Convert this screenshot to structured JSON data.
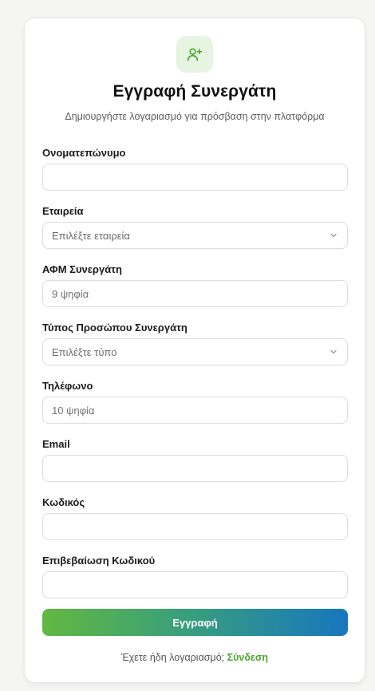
{
  "header": {
    "icon": "user-plus-icon",
    "title": "Εγγραφή Συνεργάτη",
    "subtitle": "Δημιουργήστε λογαριασμό για πρόσβαση στην πλατφόρμα"
  },
  "form": {
    "fullname": {
      "label": "Ονοματεπώνυμο",
      "value": "",
      "placeholder": ""
    },
    "company": {
      "label": "Εταιρεία",
      "selected": "Επιλέξτε εταιρεία"
    },
    "afm": {
      "label": "ΑΦΜ Συνεργάτη",
      "value": "",
      "placeholder": "9 ψηφία"
    },
    "person_type": {
      "label": "Τύπος Προσώπου Συνεργάτη",
      "selected": "Επιλέξτε τύπο"
    },
    "phone": {
      "label": "Τηλέφωνο",
      "value": "",
      "placeholder": "10 ψηφία"
    },
    "email": {
      "label": "Email",
      "value": "",
      "placeholder": ""
    },
    "password": {
      "label": "Κωδικός",
      "value": "",
      "placeholder": ""
    },
    "password_confirm": {
      "label": "Επιβεβαίωση Κωδικού",
      "value": "",
      "placeholder": ""
    },
    "submit_label": "Εγγραφή"
  },
  "footer": {
    "prompt": "Έχετε ήδη λογαριασμό; ",
    "login_label": "Σύνδεση"
  },
  "colors": {
    "accent_green": "#4ea52c",
    "gradient_start": "#62b840",
    "gradient_end": "#1776bf",
    "icon_bg": "#e6f5e1"
  }
}
